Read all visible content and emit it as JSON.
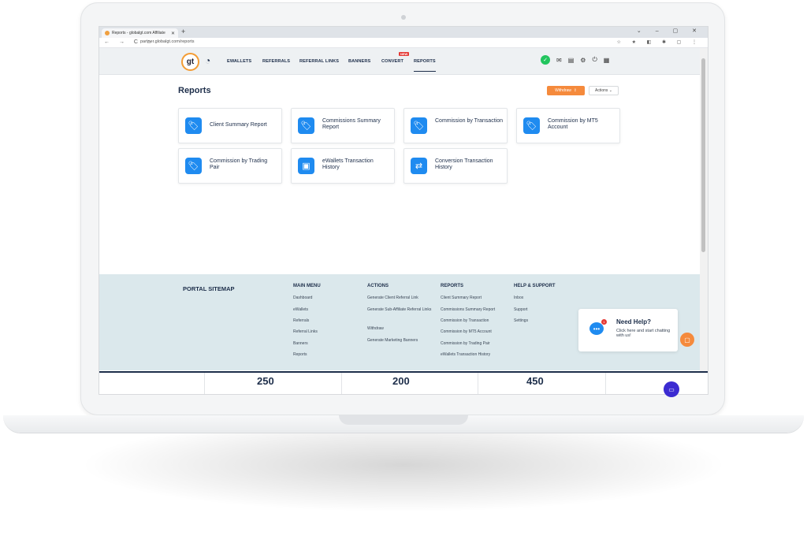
{
  "browser": {
    "tab_title": "Reports - globalgt.com Affiliate",
    "new_tab": "+",
    "window_controls": "⌄ – ▢ ✕",
    "nav_buttons": "← → C ⌂",
    "url": "partner.globalgt.com/reports",
    "extensions": "☆ ★ ◧ ✱ ▢ ⋮"
  },
  "app": {
    "logo_text": "gt",
    "nav": [
      {
        "label": "EWALLETS"
      },
      {
        "label": "REFERRALS"
      },
      {
        "label": "REFERRAL LINKS"
      },
      {
        "label": "BANNERS"
      },
      {
        "label": "CONVERT"
      },
      {
        "label": "REPORTS"
      }
    ],
    "new_badge": "NEW"
  },
  "page": {
    "title": "Reports",
    "withdraw_label": "Withdraw",
    "actions_label": "Actions"
  },
  "cards": [
    {
      "label": "Client Summary Report",
      "icon": "tag-icon"
    },
    {
      "label": "Commissions Summary Report",
      "icon": "tag-icon"
    },
    {
      "label": "Commission by Transaction",
      "icon": "tag-icon"
    },
    {
      "label": "Commission by MT5 Account",
      "icon": "tag-icon"
    },
    {
      "label": "Commission by Trading Pair",
      "icon": "tag-icon"
    },
    {
      "label": "eWallets Transaction History",
      "icon": "atm-icon"
    },
    {
      "label": "Conversion Transaction History",
      "icon": "exchange-icon"
    }
  ],
  "footer": {
    "sitemap_title": "PORTAL SITEMAP",
    "main_menu": {
      "title": "MAIN MENU",
      "links": [
        "Dashboard",
        "eWallets",
        "Referrals",
        "Referral Links",
        "Banners",
        "Reports"
      ]
    },
    "actions": {
      "title": "ACTIONS",
      "links": [
        "Generate Client Referral Link",
        "Generate Sub-Affiliate Referral Links",
        "Withdraw",
        "Generate Marketing Banners"
      ]
    },
    "reports": {
      "title": "REPORTS",
      "links": [
        "Client Summary Report",
        "Commissions Summary Report",
        "Commission by Transaction",
        "Commission by MT5 Account",
        "Commission by Trading Pair",
        "eWallets Transaction History"
      ]
    },
    "help": {
      "title": "HELP & SUPPORT",
      "links": [
        "Inbox",
        "Support",
        "Settings"
      ]
    }
  },
  "help_widget": {
    "title": "Need Help?",
    "subtitle": "Click here and start chatting with us!",
    "notif_count": "1"
  },
  "stats": [
    "250",
    "200",
    "450"
  ],
  "colors": {
    "accent": "#f58a3c",
    "primary": "#1d2e4a",
    "icon_blue": "#1f8bf0",
    "footer_bg": "#dbe8ec"
  }
}
